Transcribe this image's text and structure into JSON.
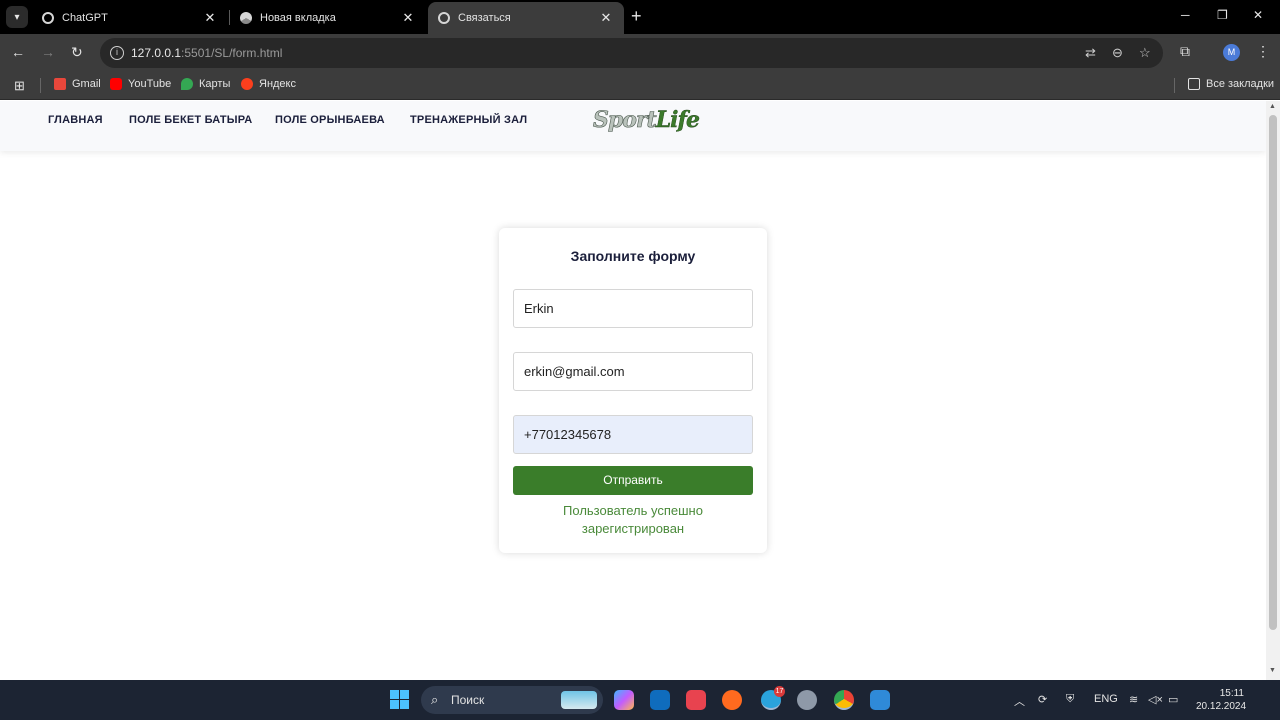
{
  "browser": {
    "tabs": [
      {
        "label": "ChatGPT",
        "active": false
      },
      {
        "label": "Новая вкладка",
        "active": false
      },
      {
        "label": "Связаться",
        "active": true
      }
    ],
    "url_host": "127.0.0.1",
    "url_path": ":5501/SL/form.html",
    "profile_initial": "M",
    "bookmarks": [
      "Gmail",
      "YouTube",
      "Карты",
      "Яндекс"
    ],
    "all_bookmarks_label": "Все закладки"
  },
  "site": {
    "nav": [
      "ГЛАВНАЯ",
      "ПОЛЕ БЕКЕТ БАТЫРА",
      "ПОЛЕ ОРЫНБАЕВА",
      "ТРЕНАЖЕРНЫЙ ЗАЛ"
    ],
    "logo_part1": "Sport",
    "logo_part2": "Life"
  },
  "form": {
    "title": "Заполните форму",
    "name_value": "Erkin",
    "email_value": "erkin@gmail.com",
    "phone_value": "+77012345678",
    "submit_label": "Отправить",
    "success_message": "Пользователь успешно зарегистрирован"
  },
  "taskbar": {
    "search_label": "Поиск",
    "telegram_badge": "17",
    "language": "ENG",
    "time": "15:11",
    "date": "20.12.2024"
  },
  "colors": {
    "accent_green": "#3a7d2a",
    "nav_text": "#1b1f3b",
    "success_text": "#4a8a3a"
  }
}
